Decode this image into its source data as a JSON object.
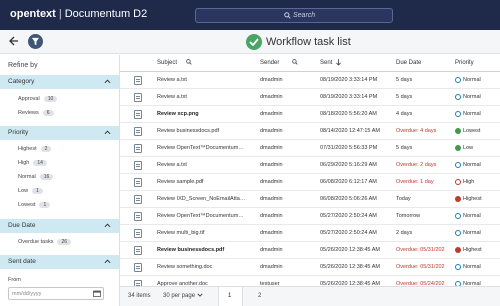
{
  "app": {
    "brand_main": "opentext",
    "brand_sep": "|",
    "brand_product": "Documentum D2"
  },
  "search": {
    "placeholder": "Search"
  },
  "page": {
    "title": "Workflow task list"
  },
  "sidebar": {
    "refine_label": "Refine by",
    "sections": [
      {
        "label": "Category",
        "items": [
          {
            "label": "Approval",
            "count": "10"
          },
          {
            "label": "Reviews",
            "count": "6"
          }
        ]
      },
      {
        "label": "Priority",
        "items": [
          {
            "label": "Highest",
            "count": "2"
          },
          {
            "label": "High",
            "count": "14"
          },
          {
            "label": "Normal",
            "count": "16"
          },
          {
            "label": "Low",
            "count": "1"
          },
          {
            "label": "Lowest",
            "count": "1"
          }
        ]
      },
      {
        "label": "Due Date",
        "items": [
          {
            "label": "Overdue tasks",
            "count": "26"
          }
        ]
      },
      {
        "label": "Sent date",
        "items": []
      }
    ],
    "from_label": "From",
    "from_placeholder": "mm/dd/yyyy"
  },
  "table": {
    "columns": {
      "subject": "Subject",
      "sender": "Sender",
      "sent": "Sent",
      "due": "Due Date",
      "priority": "Priority"
    },
    "rows": [
      {
        "subject": "Review a.txt",
        "sender": "dmadmin",
        "sent": "08/19/2020 3:33:14 PM",
        "due": "5 days",
        "due_overdue": false,
        "priority": "Normal",
        "bold": false
      },
      {
        "subject": "Review a.txt",
        "sender": "dmadmin",
        "sent": "08/19/2020 3:33:14 PM",
        "due": "5 days",
        "due_overdue": false,
        "priority": "Normal",
        "bold": false
      },
      {
        "subject": "Review xcp.png",
        "sender": "dmadmin",
        "sent": "08/18/2020 5:56:20 AM",
        "due": "4 days",
        "due_overdue": false,
        "priority": "Normal",
        "bold": true
      },
      {
        "subject": "Review businessdocs.pdf",
        "sender": "dmadmin",
        "sent": "08/14/2020 12:47:15 AM",
        "due": "Overdue: 4 days",
        "due_overdue": true,
        "priority": "Lowest",
        "bold": false
      },
      {
        "subject": "Review OpenText™Documentum…",
        "sender": "dmadmin",
        "sent": "07/31/2020 5:56:33 PM",
        "due": "5 days",
        "due_overdue": false,
        "priority": "Low",
        "bold": false
      },
      {
        "subject": "Review a.txt",
        "sender": "dmadmin",
        "sent": "06/29/2020 5:16:29 AM",
        "due": "Overdue: 2 days",
        "due_overdue": true,
        "priority": "Normal",
        "bold": false
      },
      {
        "subject": "Review sample.pdf",
        "sender": "dmadmin",
        "sent": "06/08/2020 6:12:17 AM",
        "due": "Overdue: 1 day",
        "due_overdue": true,
        "priority": "High",
        "bold": false
      },
      {
        "subject": "Review IXD_Screen_NoEmailAtta…",
        "sender": "dmadmin",
        "sent": "06/08/2020 5:06:26 AM",
        "due": "Today",
        "due_overdue": false,
        "priority": "Highest",
        "bold": false
      },
      {
        "subject": "Review OpenText™Documentum…",
        "sender": "dmadmin",
        "sent": "05/27/2020 2:50:24 AM",
        "due": "Tomorrow",
        "due_overdue": false,
        "priority": "Normal",
        "bold": false
      },
      {
        "subject": "Review multi_big.tif",
        "sender": "dmadmin",
        "sent": "05/27/2020 2:50:24 AM",
        "due": "2 days",
        "due_overdue": false,
        "priority": "Normal",
        "bold": false
      },
      {
        "subject": "Review businessdocs.pdf",
        "sender": "dmadmin",
        "sent": "05/26/2020 12:38:45 AM",
        "due": "Overdue: 05/31/202",
        "due_overdue": true,
        "priority": "Highest",
        "bold": true
      },
      {
        "subject": "Review something.doc",
        "sender": "dmadmin",
        "sent": "05/26/2020 12:38:45 AM",
        "due": "Overdue: 05/31/202",
        "due_overdue": true,
        "priority": "Normal",
        "bold": false
      },
      {
        "subject": "Approve another.doc",
        "sender": "testuser",
        "sent": "05/26/2020 12:38:45 AM",
        "due": "Overdue: 05/24/202",
        "due_overdue": true,
        "priority": "Normal",
        "bold": false
      }
    ]
  },
  "footer": {
    "items": "34 items",
    "per_page": "30 per page",
    "page1": "1",
    "page2": "2"
  },
  "colors": {
    "header": "#1f2a4a",
    "accent": "#cfe9f2",
    "overdue": "#c0392b",
    "success": "#4aa564"
  }
}
